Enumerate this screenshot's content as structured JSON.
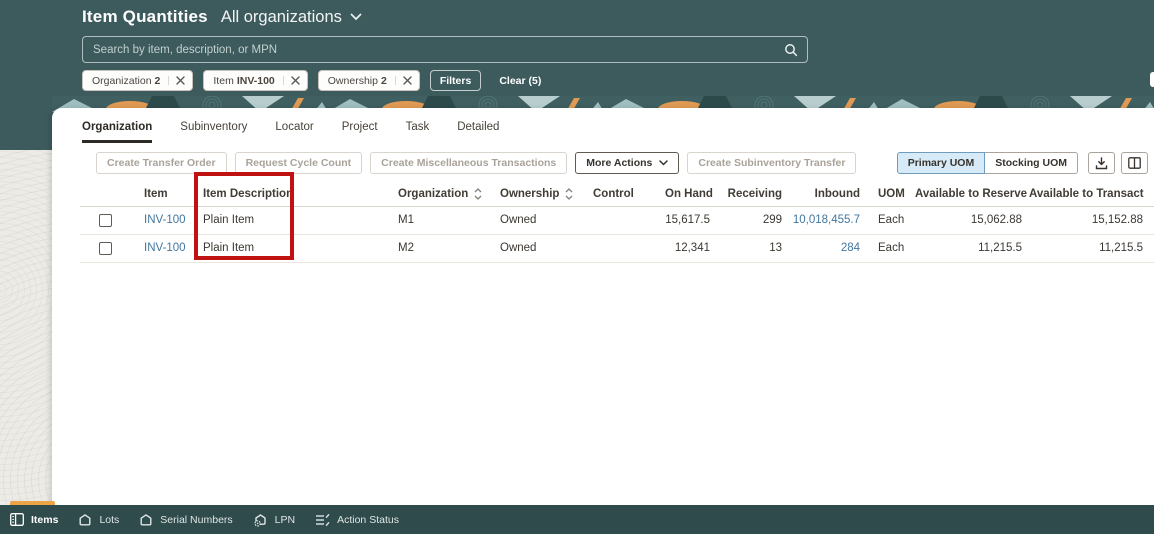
{
  "app": {
    "title": "Item Quantities",
    "org_selector": "All organizations"
  },
  "search": {
    "placeholder": "Search by item, description, or MPN"
  },
  "filters": {
    "chips": [
      {
        "label": "Organization",
        "value": "2"
      },
      {
        "label": "Item",
        "value": "INV-100"
      },
      {
        "label": "Ownership",
        "value": "2"
      }
    ],
    "filters_button": "Filters",
    "clear_button": "Clear (5)"
  },
  "tabs": [
    {
      "label": "Organization",
      "active": true
    },
    {
      "label": "Subinventory",
      "active": false
    },
    {
      "label": "Locator",
      "active": false
    },
    {
      "label": "Project",
      "active": false
    },
    {
      "label": "Task",
      "active": false
    },
    {
      "label": "Detailed",
      "active": false
    }
  ],
  "toolbar": {
    "actions": [
      {
        "label": "Create Transfer Order",
        "disabled": true
      },
      {
        "label": "Request Cycle Count",
        "disabled": true
      },
      {
        "label": "Create Miscellaneous Transactions",
        "disabled": true
      },
      {
        "label": "More Actions",
        "disabled": false,
        "has_menu": true
      },
      {
        "label": "Create Subinventory Transfer",
        "disabled": true
      }
    ],
    "uom_toggle": [
      {
        "label": "Primary UOM",
        "selected": true
      },
      {
        "label": "Stocking UOM",
        "selected": false
      }
    ],
    "icon_buttons": [
      "download-icon",
      "manage-columns-icon"
    ]
  },
  "table": {
    "columns": [
      {
        "label": ""
      },
      {
        "label": "Item"
      },
      {
        "label": "Item Description"
      },
      {
        "label": "Organization",
        "sortable": true
      },
      {
        "label": "Ownership",
        "sortable": true
      },
      {
        "label": "Control"
      },
      {
        "label": "On Hand",
        "sortable": true
      },
      {
        "label": "Receiving"
      },
      {
        "label": "Inbound"
      },
      {
        "label": "UOM"
      },
      {
        "label": "Available to Reserve"
      },
      {
        "label": "Available to Transact"
      }
    ],
    "rows": [
      {
        "item": "INV-100",
        "description": "Plain Item",
        "organization": "M1",
        "ownership": "Owned",
        "control": "",
        "on_hand": "15,617.5",
        "receiving": "299",
        "inbound": "10,018,455.7",
        "uom": "Each",
        "available_to_reserve": "15,062.88",
        "available_to_transact": "15,152.88"
      },
      {
        "item": "INV-100",
        "description": "Plain Item",
        "organization": "M2",
        "ownership": "Owned",
        "control": "",
        "on_hand": "12,341",
        "receiving": "13",
        "inbound": "284",
        "uom": "Each",
        "available_to_reserve": "11,215.5",
        "available_to_transact": "11,215.5"
      }
    ]
  },
  "annotation": {
    "type": "highlight-box",
    "target": "Item Description column",
    "color": "#c11212"
  },
  "bottom_bar": {
    "items": [
      {
        "label": "Items",
        "icon": "items-panel-icon",
        "active": true
      },
      {
        "label": "Lots",
        "icon": "lots-box-icon",
        "active": false
      },
      {
        "label": "Serial Numbers",
        "icon": "serial-numbers-box-icon",
        "active": false
      },
      {
        "label": "LPN",
        "icon": "lpn-box-gear-icon",
        "active": false
      },
      {
        "label": "Action Status",
        "icon": "action-status-list-icon",
        "active": false
      }
    ]
  },
  "colors": {
    "header_teal": "#3d5b5d",
    "bottom_bar_teal": "#2f4b4c",
    "accent_yellow": "#efa347",
    "link_blue": "#42779f",
    "highlight_red": "#c11212",
    "selected_uom_bg": "#d6eaf7"
  }
}
